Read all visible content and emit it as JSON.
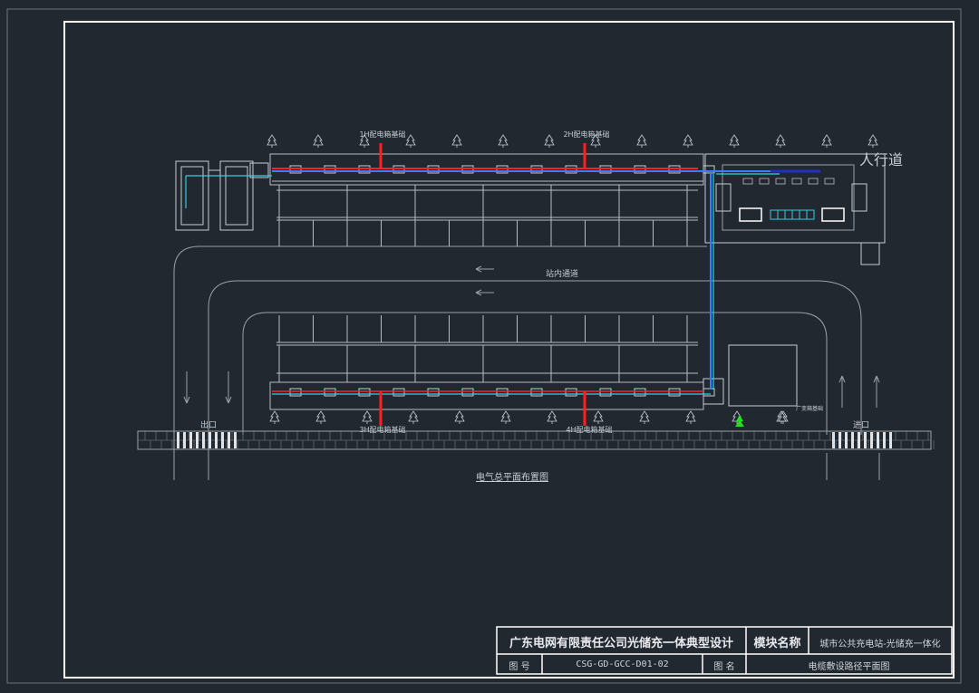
{
  "labels": {
    "pillar_1h": "1H配电箱基础",
    "pillar_2h": "2H配电箱基础",
    "pillar_3h": "3H配电箱基础",
    "pillar_4h": "4H配电箱基础",
    "sidewalk_label": "人行道",
    "road_label": "站内通道",
    "exit_label": "出口",
    "entrance_label": "进口",
    "plan_caption": "电气总平面布置图",
    "transformer_label": "广变箱基础",
    "arrow_left": "←  —"
  },
  "title_block": {
    "company_title": "广东电网有限责任公司光储充一体典型设计",
    "module_name_label": "模块名称",
    "module_name_value": "城市公共充电站-光储充一体化",
    "drawing_no_label": "图    号",
    "drawing_no_value": "CSG-GD-GCC-D01-02",
    "drawing_name_label": "图    名",
    "drawing_name_value": "电缆敷设路径平面图"
  },
  "colors": {
    "background": "#212830",
    "frame": "#ffffff",
    "lines": "#c8ccd2",
    "cable_red": "#ff2020",
    "cable_blue": "#3a7bff",
    "cable_cyan": "#30d0e0",
    "tree_green": "#20e020"
  }
}
